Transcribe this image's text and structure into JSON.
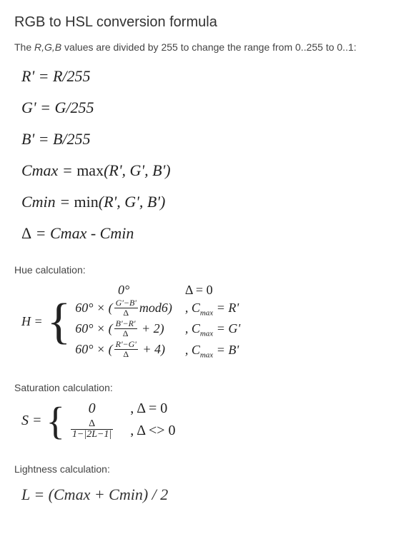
{
  "title": "RGB to HSL conversion formula",
  "intro": {
    "vars": "R,G,B",
    "text_before": "The ",
    "text_after": " values are divided by 255 to change the range from 0..255 to 0..1:"
  },
  "formulas": {
    "r_prime": "R' = R/255",
    "g_prime": "G' = G/255",
    "b_prime": "B' = B/255",
    "cmax_lhs": "Cmax",
    "cmax_eq": " = ",
    "cmax_fn": "max",
    "cmax_args": "(R', G', B')",
    "cmin_lhs": "Cmin",
    "cmin_eq": " = ",
    "cmin_fn": "min",
    "cmin_args": "(R', G', B')",
    "delta_lhs": "Δ",
    "delta_rhs": " = Cmax - Cmin"
  },
  "hue": {
    "label": "Hue calculation:",
    "lhs": "H =",
    "case0_expr": "0°",
    "case0_cond": "Δ = 0",
    "deg60": "60° × (",
    "mod6": "mod6)",
    "plus2": " + 2)",
    "plus4": " + 4)",
    "frac1_num": "G'−B'",
    "frac2_num": "B'−R'",
    "frac3_num": "R'−G'",
    "frac_den": "Δ",
    "cond_prefix": ", C",
    "cond_sub": "max",
    "cond_eq": " = ",
    "cond1_val": "R'",
    "cond2_val": "G'",
    "cond3_val": "B'"
  },
  "saturation": {
    "label": "Saturation calculation:",
    "lhs": "S =",
    "case0_expr": "0",
    "case0_cond": ", Δ = 0",
    "frac_num": "Δ",
    "frac_den": "1−|2L−1|",
    "case1_cond": ", Δ <> 0"
  },
  "lightness": {
    "label": "Lightness calculation:",
    "formula": "L = (Cmax + Cmin) / 2"
  }
}
